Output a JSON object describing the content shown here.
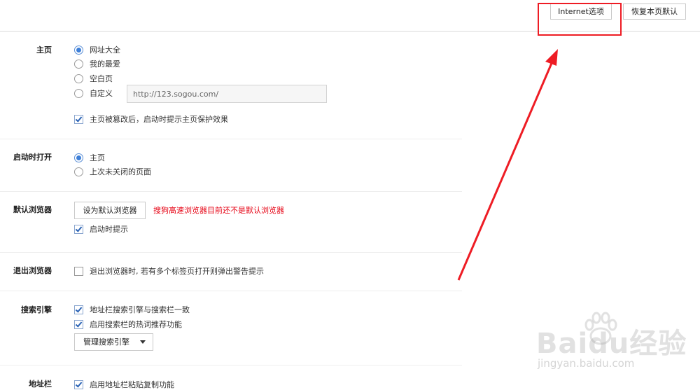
{
  "topbar": {
    "internet_options": "Internet选项",
    "restore_defaults": "恢复本页默认"
  },
  "sections": {
    "homepage": {
      "label": "主页",
      "options": [
        "网址大全",
        "我的最爱",
        "空白页",
        "自定义"
      ],
      "selected_index": 0,
      "custom_url": "http://123.sogou.com/",
      "protect_checkbox": "主页被篡改后，启动时提示主页保护效果",
      "protect_checked": true
    },
    "startup": {
      "label": "启动时打开",
      "options": [
        "主页",
        "上次未关闭的页面"
      ],
      "selected_index": 0
    },
    "default_browser": {
      "label": "默认浏览器",
      "button": "设为默认浏览器",
      "warning": "搜狗高速浏览器目前还不是默认浏览器",
      "prompt_checkbox": "启动时提示",
      "prompt_checked": true
    },
    "exit_browser": {
      "label": "退出浏览器",
      "warn_checkbox": "退出浏览器时, 若有多个标签页打开则弹出警告提示",
      "warn_checked": false
    },
    "search_engine": {
      "label": "搜索引擎",
      "sync_checkbox": "地址栏搜索引擎与搜索栏一致",
      "sync_checked": true,
      "hot_checkbox": "启用搜索栏的热词推荐功能",
      "hot_checked": true,
      "manage_button": "管理搜索引擎"
    },
    "address_bar": {
      "label": "地址栏",
      "paste_checkbox": "启用地址栏粘贴复制功能",
      "paste_checked": true
    }
  },
  "annotation": {
    "color": "#ee1c24"
  },
  "watermark": {
    "brand": "Baidu经验",
    "url": "jingyan.baidu.com"
  }
}
